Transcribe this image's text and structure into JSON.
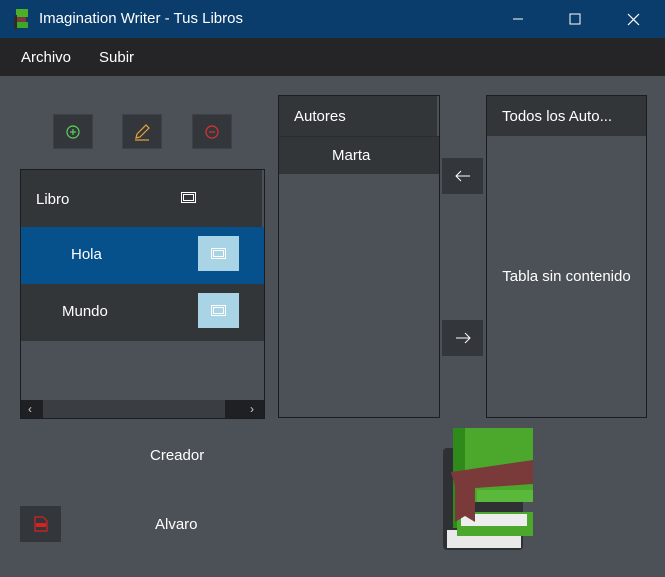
{
  "window": {
    "title": "Imagination Writer - Tus Libros"
  },
  "menu": {
    "items": [
      "Archivo",
      "Subir"
    ]
  },
  "toolbar": {
    "add_icon": "plus-circle-icon",
    "edit_icon": "pencil-icon",
    "remove_icon": "minus-circle-icon"
  },
  "books": {
    "header": "Libro",
    "rows": [
      {
        "label": "Hola",
        "selected": true
      },
      {
        "label": "Mundo",
        "selected": false
      }
    ]
  },
  "authors": {
    "header": "Autores",
    "rows": [
      "Marta"
    ]
  },
  "all_authors": {
    "header": "Todos los Auto...",
    "empty_text": "Tabla sin contenido"
  },
  "info": {
    "creator_label": "Creador",
    "creator_value": "Alvaro"
  },
  "colors": {
    "titlebar": "#0a3d6b",
    "menubar": "#252528",
    "background": "#4c5157",
    "selection": "#06508c",
    "add": "#5bd45b",
    "edit": "#e8a23a",
    "remove": "#e03333",
    "pdf": "#d82222"
  }
}
